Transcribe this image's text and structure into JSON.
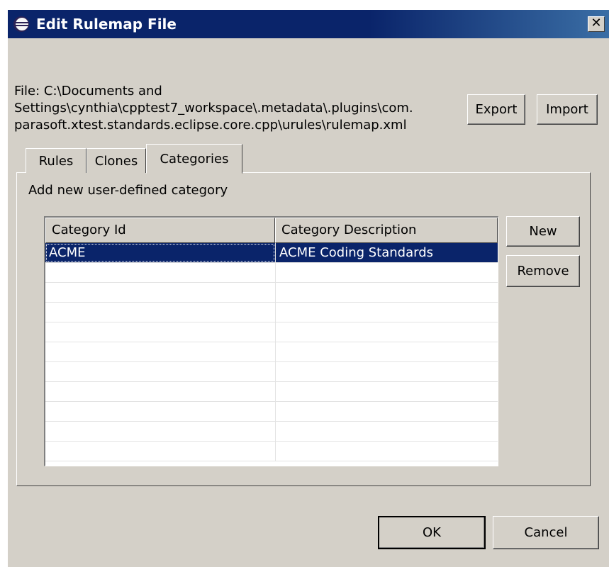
{
  "window": {
    "title": "Edit Rulemap File",
    "close_glyph": "✕"
  },
  "file": {
    "label": "File: C:\\Documents and\nSettings\\cynthia\\cpptest7_workspace\\.metadata\\.plugins\\com.\nparasoft.xtest.standards.eclipse.core.cpp\\urules\\rulemap.xml"
  },
  "toolbar": {
    "export_label": "Export",
    "import_label": "Import"
  },
  "tabs": [
    {
      "label": "Rules",
      "selected": false
    },
    {
      "label": "Clones",
      "selected": false
    },
    {
      "label": "Categories",
      "selected": true
    }
  ],
  "categories": {
    "heading": "Add new user-defined category",
    "columns": [
      "Category Id",
      "Category Description"
    ],
    "rows": [
      {
        "id": "ACME",
        "description": "ACME Coding Standards",
        "selected": true
      },
      {
        "id": "",
        "description": "",
        "selected": false
      },
      {
        "id": "",
        "description": "",
        "selected": false
      },
      {
        "id": "",
        "description": "",
        "selected": false
      },
      {
        "id": "",
        "description": "",
        "selected": false
      },
      {
        "id": "",
        "description": "",
        "selected": false
      },
      {
        "id": "",
        "description": "",
        "selected": false
      },
      {
        "id": "",
        "description": "",
        "selected": false
      },
      {
        "id": "",
        "description": "",
        "selected": false
      },
      {
        "id": "",
        "description": "",
        "selected": false
      },
      {
        "id": "",
        "description": "",
        "selected": false
      }
    ],
    "new_label": "New",
    "remove_label": "Remove"
  },
  "footer": {
    "ok_label": "OK",
    "cancel_label": "Cancel"
  },
  "colors": {
    "dialog_bg": "#d4d0c8",
    "titlebar": "#0a246a",
    "selection": "#0a246a"
  },
  "icons": {
    "app": "eclipse-icon",
    "close": "close-icon"
  }
}
